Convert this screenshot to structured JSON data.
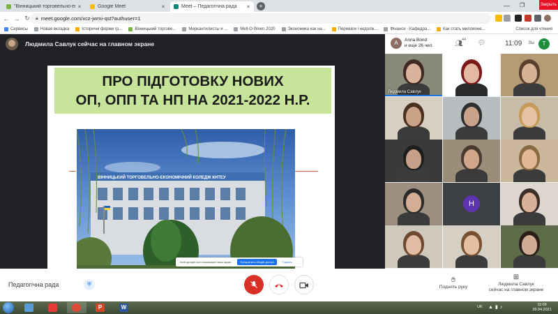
{
  "browser": {
    "tabs": [
      {
        "label": "\"Вінницький торговельно-еконо...",
        "active": false,
        "favicon_color": "#7cb342"
      },
      {
        "label": "Google Meet",
        "active": false,
        "favicon_color": "#fbbc04"
      },
      {
        "label": "Meet – Педагогічна рада",
        "active": true,
        "favicon_color": "#00897b"
      }
    ],
    "new_tab_label": "+",
    "close_tooltip": "Закрыть",
    "url": "meet.google.com/xcz-jwmi-qst?authuser=1",
    "bookmarks": [
      {
        "label": "Сервисы",
        "color": "#4285f4"
      },
      {
        "label": "Новая вкладка",
        "color": "#9aa0a6"
      },
      {
        "label": "Історичні форми гр...",
        "color": "#f9ab00"
      },
      {
        "label": "Вінницький торгове...",
        "color": "#7cb342"
      },
      {
        "label": "Меркантилисты и ...",
        "color": "#9aa0a6"
      },
      {
        "label": "Mell-O-Ween 2020",
        "color": "#9aa0a6"
      },
      {
        "label": "Экономика как на...",
        "color": "#9aa0a6"
      },
      {
        "label": "Переваги і недолік...",
        "color": "#f9ab00"
      },
      {
        "label": "Фінанси - Кафедра...",
        "color": "#9aa0a6"
      },
      {
        "label": "Как стать миллионе...",
        "color": "#f9ab00"
      }
    ],
    "reading_list": "Список для чтения"
  },
  "meet": {
    "presenting_text": "Людмила Савлук сейчас на главном экране",
    "pinned": {
      "initial": "A",
      "name": "Anna Bond",
      "others": "и еще 26 чел."
    },
    "people_count": "44",
    "clock": "11:09",
    "you_label": "Вы",
    "self_initial": "T",
    "slide": {
      "title_line1": "ПРО ПІДГОТОВКУ НОВИХ",
      "title_line2": "ОП, ОПП ТА НП НА 2021-2022 Н.Р.",
      "building_sign": "ВІННИЦЬКИЙ ТОРГОВЕЛЬНО-ЕКОНОМІЧНИЙ КОЛЕДЖ КНТЕУ"
    },
    "sharing_bar": {
      "text": "meet.google.com показывает ваш экран.",
      "stop_label": "Прекратить общий доступ",
      "hide_label": "Скрыть"
    },
    "participants": [
      {
        "name": "Людмила Савлук",
        "letter": "",
        "bg": "#8a8a7a",
        "skin": "#d9b49a",
        "hair": "#3e2a22"
      },
      {
        "name": "",
        "letter": "",
        "bg": "#ffffff",
        "skin": "#e3b8a0",
        "hair": "#7a1a1a"
      },
      {
        "name": "",
        "letter": "",
        "bg": "#b59a74",
        "skin": "#d6b394",
        "hair": "#5a3e2e"
      },
      {
        "name": "",
        "letter": "",
        "bg": "#d8cfc3",
        "skin": "#caa288",
        "hair": "#4a3020"
      },
      {
        "name": "",
        "letter": "",
        "bg": "#b7bcbf",
        "skin": "#c9a28a",
        "hair": "#2e2e2e"
      },
      {
        "name": "",
        "letter": "",
        "bg": "#c7bca8",
        "skin": "#e5c2a4",
        "hair": "#c79a5a"
      },
      {
        "name": "",
        "letter": "",
        "bg": "#3a3a3a",
        "skin": "#c6a18a",
        "hair": "#1e1e1e"
      },
      {
        "name": "",
        "letter": "",
        "bg": "#9b8d7a",
        "skin": "#d2a68c",
        "hair": "#4a3a30"
      },
      {
        "name": "",
        "letter": "",
        "bg": "#cbb79c",
        "skin": "#e0b898",
        "hair": "#8a6a40"
      },
      {
        "name": "",
        "letter": "",
        "bg": "#9c8f80",
        "skin": "#d3ae94",
        "hair": "#2a2a2a"
      },
      {
        "name": "",
        "letter": "H",
        "bg": "#3c4043",
        "skin": "",
        "hair": ""
      },
      {
        "name": "",
        "letter": "",
        "bg": "#dcd6cc",
        "skin": "#d9b198",
        "hair": "#3a2e26"
      },
      {
        "name": "",
        "letter": "",
        "bg": "#cfc8bd",
        "skin": "#e0bca2",
        "hair": "#6e4a30"
      },
      {
        "name": "",
        "letter": "",
        "bg": "#d6d0c4",
        "skin": "#e4c0a2",
        "hair": "#7a5232"
      },
      {
        "name": "",
        "letter": "",
        "bg": "#5e6b48",
        "skin": "#d2ad95",
        "hair": "#2c1e18"
      }
    ],
    "controls": {
      "meeting_name": "Педагогічна рада",
      "raise_hand": "Поднять руку",
      "presenting_line1": "Людмила Савлук",
      "presenting_line2": "сейчас на главном экране"
    }
  },
  "taskbar": {
    "apps": [
      {
        "name": "chrome",
        "color": "#dd4b39",
        "glyph": ""
      },
      {
        "name": "powerpoint",
        "color": "#d24726",
        "glyph": "P"
      },
      {
        "name": "word",
        "color": "#2b579a",
        "glyph": "W"
      }
    ],
    "lang": "UK",
    "time": "11:09",
    "date": "28.04.2021"
  },
  "colors": {
    "accent": "#1a73e8",
    "danger": "#d93025",
    "slide_title_bg": "#c6e49a"
  }
}
